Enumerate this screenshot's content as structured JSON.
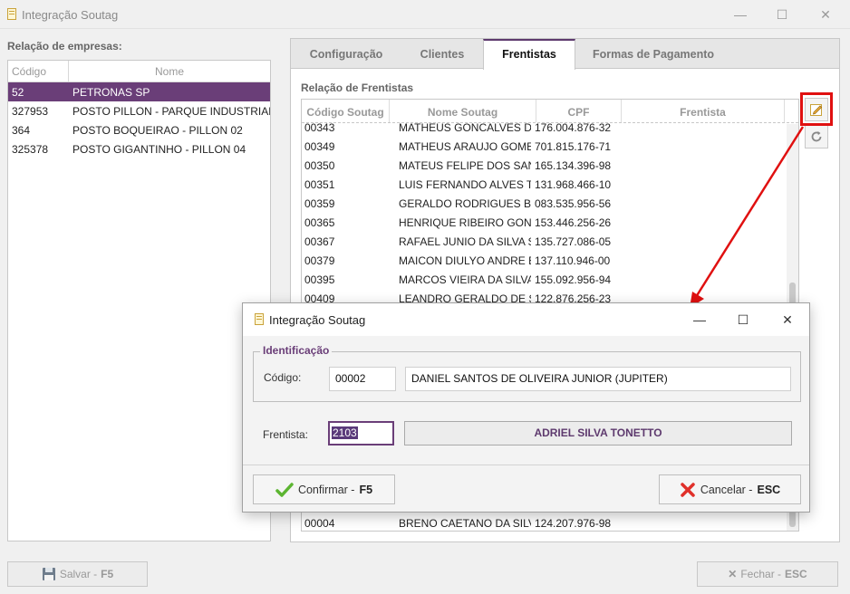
{
  "window": {
    "title": "Integração Soutag",
    "minimize_glyph": "—",
    "maximize_glyph": "☐",
    "close_glyph": "✕"
  },
  "empresas": {
    "label": "Relação de empresas:",
    "columns": [
      "Código",
      "Nome"
    ],
    "rows": [
      {
        "codigo": "52",
        "nome": "PETRONAS SP",
        "selected": true
      },
      {
        "codigo": "327953",
        "nome": "POSTO PILLON - PARQUE INDUSTRIAL -",
        "selected": false
      },
      {
        "codigo": "364",
        "nome": "POSTO BOQUEIRAO - PILLON 02",
        "selected": false
      },
      {
        "codigo": "325378",
        "nome": "POSTO GIGANTINHO - PILLON 04",
        "selected": false
      }
    ]
  },
  "tabs": [
    {
      "label": "Configuração",
      "active": false
    },
    {
      "label": "Clientes",
      "active": false
    },
    {
      "label": "Frentistas",
      "active": true
    },
    {
      "label": "Formas de Pagamento",
      "active": false
    }
  ],
  "frentistas": {
    "label": "Relação de Frentistas",
    "columns": [
      "Código Soutag",
      "Nome Soutag",
      "CPF",
      "Frentista"
    ],
    "rows": [
      {
        "codigo": "00343",
        "nome": "MATHEUS GONCALVES DOS",
        "cpf": "176.004.876-32"
      },
      {
        "codigo": "00349",
        "nome": "MATHEUS ARAUJO GOMES",
        "cpf": "701.815.176-71"
      },
      {
        "codigo": "00350",
        "nome": "MATEUS FELIPE DOS SANTO",
        "cpf": "165.134.396-98"
      },
      {
        "codigo": "00351",
        "nome": "LUIS FERNANDO ALVES TEI",
        "cpf": "131.968.466-10"
      },
      {
        "codigo": "00359",
        "nome": "GERALDO RODRIGUES BAR",
        "cpf": "083.535.956-56"
      },
      {
        "codigo": "00365",
        "nome": "HENRIQUE RIBEIRO GONCA",
        "cpf": "153.446.256-26"
      },
      {
        "codigo": "00367",
        "nome": "RAFAEL JUNIO DA SILVA SA",
        "cpf": "135.727.086-05"
      },
      {
        "codigo": "00379",
        "nome": "MAICON DIULYO ANDRE BI",
        "cpf": "137.110.946-00"
      },
      {
        "codigo": "00395",
        "nome": "MARCOS VIEIRA DA SILVA (",
        "cpf": "155.092.956-94"
      },
      {
        "codigo": "00409",
        "nome": "LEANDRO GERALDO DE SO",
        "cpf": "122.876.256-23"
      }
    ],
    "bottom_row": {
      "codigo": "00004",
      "nome": "BRENO CAETANO DA SILVA",
      "cpf": "124.207.976-98"
    }
  },
  "bottom_bar": {
    "save_label": "Salvar - ",
    "save_key": "F5",
    "close_label": "Fechar - ",
    "close_key": "ESC"
  },
  "dialog": {
    "title": "Integração Soutag",
    "group_title": "Identificação",
    "codigo_label": "Código:",
    "codigo_value": "00002",
    "nome_value": "DANIEL SANTOS DE OLIVEIRA JUNIOR (JUPITER)",
    "frentista_label": "Frentista:",
    "frentista_value": "2103",
    "frentista_nome": "ADRIEL SILVA TONETTO",
    "confirm_label": "Confirmar - ",
    "confirm_key": "F5",
    "cancel_label": "Cancelar - ",
    "cancel_key": "ESC"
  },
  "colors": {
    "accent": "#6a3e78",
    "annotation_red": "#e01010"
  }
}
